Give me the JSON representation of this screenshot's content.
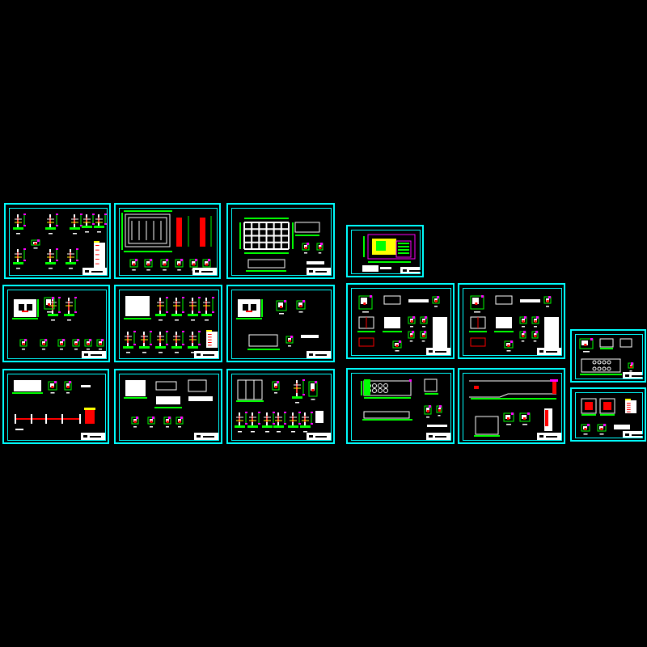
{
  "view": {
    "background": "#000000",
    "frame_color": "#00ffff"
  },
  "colors": {
    "green": "#00ff00",
    "white": "#ffffff",
    "red": "#ff0000",
    "magenta": "#ff00ff",
    "yellow": "#ffff00",
    "cyan": "#00ffff"
  },
  "sheets": [
    {
      "id": "s1",
      "content": "column-details"
    },
    {
      "id": "s2",
      "content": "foundation-plan"
    },
    {
      "id": "s3",
      "content": "beam-grid-plan"
    },
    {
      "id": "s4",
      "content": "site-plan-colored"
    },
    {
      "id": "s5",
      "content": "tank-sections"
    },
    {
      "id": "s6",
      "content": "column-details"
    },
    {
      "id": "s7",
      "content": "tank-sections"
    },
    {
      "id": "s8",
      "content": "pool-details"
    },
    {
      "id": "s9",
      "content": "pool-details"
    },
    {
      "id": "s10",
      "content": "tank-plan"
    },
    {
      "id": "s11",
      "content": "long-section"
    },
    {
      "id": "s12",
      "content": "tank-plan"
    },
    {
      "id": "s13",
      "content": "section-details"
    },
    {
      "id": "s14",
      "content": "tank-plan"
    },
    {
      "id": "s15",
      "content": "pipeline-profile"
    },
    {
      "id": "s16",
      "content": "column-details"
    }
  ]
}
